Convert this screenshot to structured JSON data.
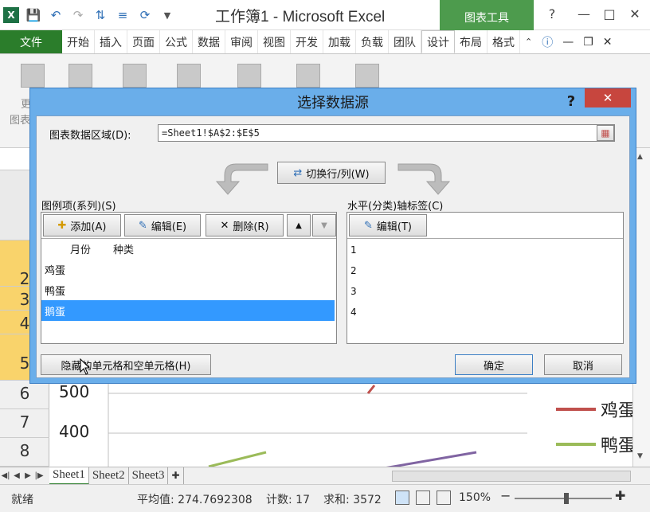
{
  "app": {
    "title": "工作簿1 - Microsoft Excel",
    "context_tab": "图表工具"
  },
  "tabs": [
    {
      "label": "文件"
    },
    {
      "label": "开始"
    },
    {
      "label": "插入"
    },
    {
      "label": "页面"
    },
    {
      "label": "公式"
    },
    {
      "label": "数据"
    },
    {
      "label": "审阅"
    },
    {
      "label": "视图"
    },
    {
      "label": "开发"
    },
    {
      "label": "加载"
    },
    {
      "label": "负载"
    },
    {
      "label": "团队"
    },
    {
      "label": "设计"
    },
    {
      "label": "布局"
    },
    {
      "label": "格式"
    }
  ],
  "ribbon": {
    "partial_label_1": "更",
    "partial_label_2": "图表"
  },
  "sheet": {
    "row_numbers": [
      "2",
      "3",
      "4",
      "5",
      "6",
      "7",
      "8"
    ],
    "y_ticks": [
      "500",
      "400"
    ],
    "legend": [
      "鸡蛋",
      "鸭蛋"
    ]
  },
  "sheet_tabs": [
    "Sheet1",
    "Sheet2",
    "Sheet3"
  ],
  "status": {
    "mode": "就绪",
    "average": "平均值: 274.7692308",
    "count": "计数: 17",
    "sum": "求和: 3572",
    "zoom": "150%"
  },
  "dialog": {
    "title": "选择数据源",
    "help": "?",
    "range_label": "图表数据区域(D):",
    "range_value": "=Sheet1!$A$2:$E$5",
    "switch_button": "切换行/列(W)",
    "series_label": "图例项(系列)(S)",
    "add_button": "添加(A)",
    "edit_button": "编辑(E)",
    "delete_button": "删除(R)",
    "series_header": [
      "月份",
      "种类"
    ],
    "series": [
      "鸡蛋",
      "鸭蛋",
      "鹅蛋"
    ],
    "selected_series": "鹅蛋",
    "category_label": "水平(分类)轴标签(C)",
    "category_edit_button": "编辑(T)",
    "categories": [
      "1",
      "2",
      "3",
      "4"
    ],
    "hidden_cells_button": "隐藏的单元格和空单元格(H)",
    "ok_button": "确定",
    "cancel_button": "取消"
  },
  "colors": {
    "series_egg_chicken": "#c0504d",
    "series_egg_duck": "#9bbb59",
    "series_goose": "#8064a2",
    "dialog_frame": "#6aaeea",
    "selection": "#3399ff",
    "file_tab": "#2b7d2b"
  }
}
